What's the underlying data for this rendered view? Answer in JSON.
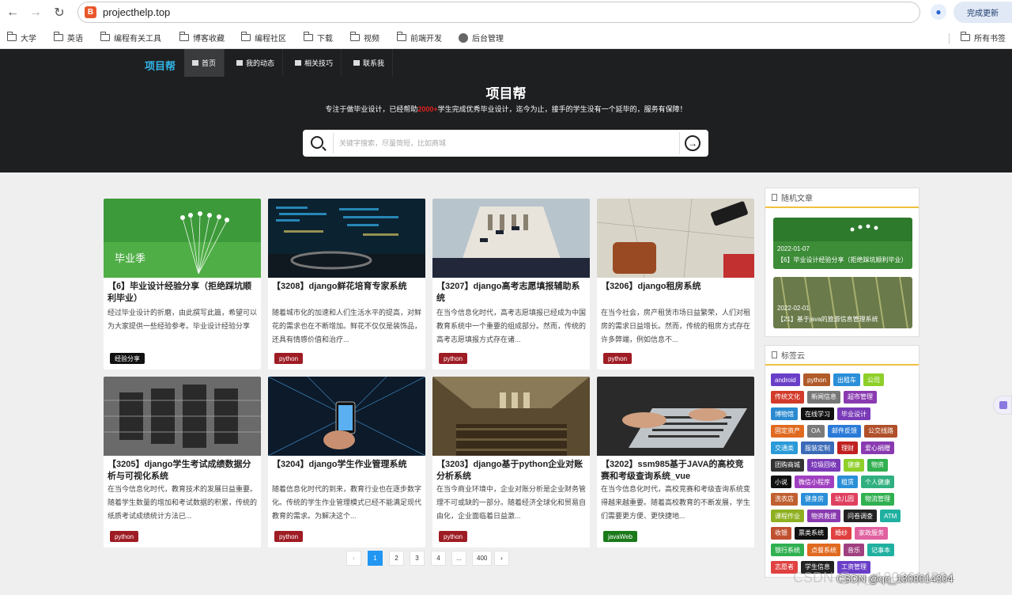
{
  "browser": {
    "url": "projecthelp.top",
    "update_label": "完成更新",
    "bookmarks": [
      "大学",
      "英语",
      "编程有关工具",
      "博客收藏",
      "编程社区",
      "下载",
      "视频",
      "前端开发",
      "后台管理"
    ],
    "all_bookmarks": "所有书签"
  },
  "header": {
    "logo": "项目帮",
    "nav": [
      "首页",
      "我的动态",
      "相关技巧",
      "联系我"
    ],
    "hero_title": "项目帮",
    "hero_sub_pre": "专注于做毕业设计，已经帮助",
    "hero_sub_hl": "2000+",
    "hero_sub_post": "学生完成优秀毕业设计，迄今为止，接手的学生没有一个延毕的，服务有保障！",
    "search_placeholder": "关键字搜索，尽量简短，比如商城"
  },
  "cards": [
    {
      "title": "【6】毕业设计经验分享（拒绝踩坑顺利毕业）",
      "desc": "经过毕业设计的折磨，由此撰写此篇，希望可以为大家提供一些经验参考。毕业设计经验分享",
      "tag": "经验分享",
      "tag_color": "#111111"
    },
    {
      "title": "【3208】django鲜花培育专家系统",
      "desc": "随着城市化的加速和人们生活水平的提高，对鲜花的需求也在不断增加。鲜花不仅仅是装饰品，还具有情感价值和治疗...",
      "tag": "python",
      "tag_color": "#9e1c24"
    },
    {
      "title": "【3207】django高考志愿填报辅助系统",
      "desc": "在当今信息化时代，高考志愿填报已经成为中国教育系统中一个重要的组成部分。然而，传统的高考志愿填报方式存在诸...",
      "tag": "python",
      "tag_color": "#9e1c24"
    },
    {
      "title": "【3206】django租房系统",
      "desc": "在当今社会，房产租赁市场日益繁荣，人们对租房的需求日益增长。然而，传统的租房方式存在许多弊端，例如信息不...",
      "tag": "python",
      "tag_color": "#9e1c24"
    },
    {
      "title": "【3205】django学生考试成绩数据分析与可视化系统",
      "desc": "在当今信息化时代，教育技术的发展日益重要。随着学生数量的增加和考试数据的积累，传统的纸质考试成绩统计方法已...",
      "tag": "python",
      "tag_color": "#9e1c24"
    },
    {
      "title": "【3204】django学生作业管理系统",
      "desc": "随着信息化时代的到来，教育行业也在逐步数字化。传统的学生作业管理模式已经不能满足现代教育的需求。为解决这个...",
      "tag": "python",
      "tag_color": "#9e1c24"
    },
    {
      "title": "【3203】django基于python企业对账分析系统",
      "desc": "在当今商业环境中，企业对账分析是企业财务管理不可或缺的一部分。随着经济全球化和贸易自由化，企业面临着日益激...",
      "tag": "python",
      "tag_color": "#9e1c24"
    },
    {
      "title": "【3202】ssm985基于JAVA的高校竞赛和考级查询系统_vue",
      "desc": "在当今信息化时代，高校竞赛和考级查询系统变得越来越重要。随着高校教育的不断发展，学生们需要更方便、更快捷地...",
      "tag": "javaWeb",
      "tag_color": "#1a7a1a"
    }
  ],
  "pagination": [
    "‹",
    "1",
    "2",
    "3",
    "4",
    "...",
    "400",
    "›"
  ],
  "sidebar": {
    "random_title": "随机文章",
    "random": [
      {
        "date": "2022-01-07",
        "title": "【6】毕业设计经验分享（拒绝踩坑顺利毕业）"
      },
      {
        "date": "2022-02-01",
        "title": "【21】基于java的旅游信息管理系统"
      }
    ],
    "tags_title": "标签云",
    "tags": [
      {
        "label": "android",
        "color": "#6a3fc8"
      },
      {
        "label": "python",
        "color": "#b05b2a"
      },
      {
        "label": "出租车",
        "color": "#2a8fd8"
      },
      {
        "label": "公司",
        "color": "#8fcf2a"
      },
      {
        "label": "传统文化",
        "color": "#d23a2a"
      },
      {
        "label": "新闻信息",
        "color": "#777777"
      },
      {
        "label": "超市管理",
        "color": "#8a3ab0"
      },
      {
        "label": "博物馆",
        "color": "#2a8ad0"
      },
      {
        "label": "在线学习",
        "color": "#111111"
      },
      {
        "label": "毕业设计",
        "color": "#7a3ab8"
      },
      {
        "label": "固定资产",
        "color": "#e06a20"
      },
      {
        "label": "OA",
        "color": "#7a7a7a"
      },
      {
        "label": "邮件反馈",
        "color": "#2a7ad8"
      },
      {
        "label": "公交线路",
        "color": "#b0502a"
      },
      {
        "label": "交通类",
        "color": "#2a9ad8"
      },
      {
        "label": "服装定制",
        "color": "#3a6ab8"
      },
      {
        "label": "理财",
        "color": "#c02020"
      },
      {
        "label": "爱心捐赠",
        "color": "#8a3ab0"
      },
      {
        "label": "团购商城",
        "color": "#333333"
      },
      {
        "label": "垃圾回收",
        "color": "#7a3ab8"
      },
      {
        "label": "健康",
        "color": "#8fcf2a"
      },
      {
        "label": "物资",
        "color": "#30b050"
      },
      {
        "label": "小说",
        "color": "#111111"
      },
      {
        "label": "微信小程序",
        "color": "#a040c0"
      },
      {
        "label": "租赁",
        "color": "#2a8fd8"
      },
      {
        "label": "个人健康",
        "color": "#30b080"
      },
      {
        "label": "洗衣店",
        "color": "#c06030"
      },
      {
        "label": "健身房",
        "color": "#2a8fd8"
      },
      {
        "label": "幼儿园",
        "color": "#e04060"
      },
      {
        "label": "物流管理",
        "color": "#30b050"
      },
      {
        "label": "课程作业",
        "color": "#8fb020"
      },
      {
        "label": "物资救援",
        "color": "#8a3ab0"
      },
      {
        "label": "问卷调查",
        "color": "#222222"
      },
      {
        "label": "ATM",
        "color": "#20b0a0"
      },
      {
        "label": "收银",
        "color": "#c05030"
      },
      {
        "label": "票类系统",
        "color": "#111111"
      },
      {
        "label": "婚纱",
        "color": "#e04040"
      },
      {
        "label": "家政服务",
        "color": "#e060a0"
      },
      {
        "label": "银行系统",
        "color": "#30b050"
      },
      {
        "label": "点餐系统",
        "color": "#e06a20"
      },
      {
        "label": "音乐",
        "color": "#a04080"
      },
      {
        "label": "记事本",
        "color": "#20b0a0"
      },
      {
        "label": "志愿者",
        "color": "#e04040"
      },
      {
        "label": "学生信息",
        "color": "#222222"
      },
      {
        "label": "工资管理",
        "color": "#6a3fc8"
      }
    ]
  },
  "watermark": "CSDN @qq_1808614304"
}
